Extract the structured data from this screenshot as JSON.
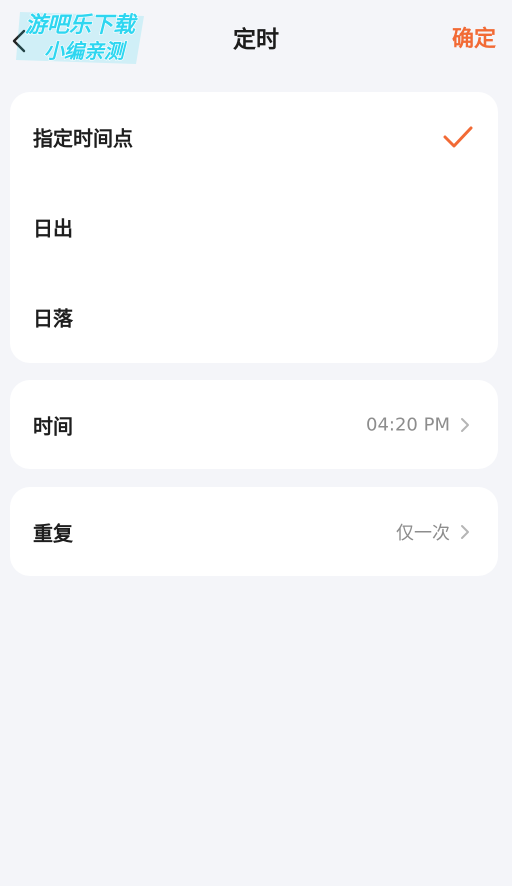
{
  "header": {
    "title": "定时",
    "confirm_label": "确定",
    "back_icon": "chevron-left-icon"
  },
  "watermark": {
    "line1": "游吧乐下载",
    "line2": "小编亲测"
  },
  "options": [
    {
      "label": "指定时间点",
      "selected": true
    },
    {
      "label": "日出",
      "selected": false
    },
    {
      "label": "日落",
      "selected": false
    }
  ],
  "time_setting": {
    "label": "时间",
    "value": "04:20 PM"
  },
  "repeat_setting": {
    "label": "重复",
    "value": "仅一次"
  },
  "colors": {
    "accent": "#f26a35",
    "background": "#f4f5f9",
    "card": "#ffffff",
    "watermark": "#2ed6f0"
  }
}
